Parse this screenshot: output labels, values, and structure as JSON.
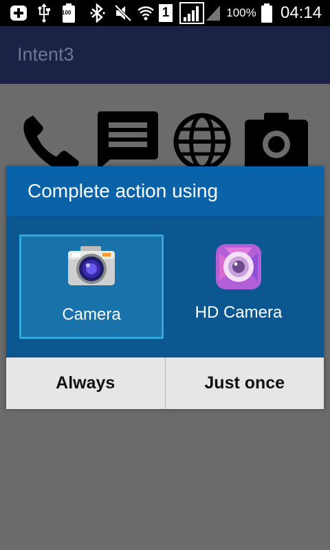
{
  "status_bar": {
    "icons": [
      "add-box-icon",
      "usb-icon",
      "battery-small-icon",
      "bluetooth-icon",
      "mute-icon",
      "wifi-icon",
      "sim-icon",
      "signal-strong-icon",
      "signal-weak-icon",
      "battery-icon"
    ],
    "sim_number": "1",
    "battery_small_label": "100",
    "battery_percent": "100%",
    "time": "04:14"
  },
  "app_bar": {
    "title": "Intent3"
  },
  "background_icons": [
    "phone-icon",
    "message-icon",
    "globe-icon",
    "camera-icon"
  ],
  "dialog": {
    "title": "Complete action using",
    "choices": [
      {
        "label": "Camera",
        "icon": "camera-app-icon",
        "selected": true
      },
      {
        "label": "HD Camera",
        "icon": "hd-camera-app-icon",
        "selected": false
      }
    ],
    "buttons": {
      "always": "Always",
      "just_once": "Just once"
    }
  },
  "colors": {
    "status_bar": "#000000",
    "app_bar": "#1a2246",
    "dialog_header": "#0a63a8",
    "dialog_body": "#0d5791",
    "selected_border": "#34a8dc",
    "button_bar": "#e6e6e6"
  }
}
